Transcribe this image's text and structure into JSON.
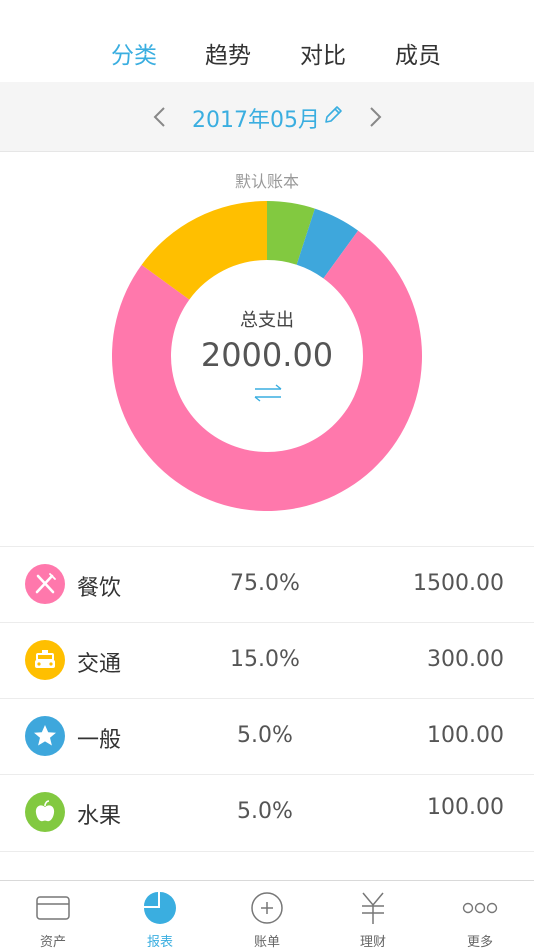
{
  "top_tabs": [
    {
      "label": "分类",
      "active": true
    },
    {
      "label": "趋势",
      "active": false
    },
    {
      "label": "对比",
      "active": false
    },
    {
      "label": "成员",
      "active": false
    }
  ],
  "date_bar": {
    "label": "2017年05月"
  },
  "book_name": "默认账本",
  "summary": {
    "title": "总支出",
    "total": "2000.00"
  },
  "categories": [
    {
      "name": "餐饮",
      "percent": "75.0%",
      "amount": "1500.00",
      "color": "#ff78ac",
      "icon": "fork-knife-icon"
    },
    {
      "name": "交通",
      "percent": "15.0%",
      "amount": "300.00",
      "color": "#ffbf00",
      "icon": "taxi-icon"
    },
    {
      "name": "一般",
      "percent": "5.0%",
      "amount": "100.00",
      "color": "#3ea7dc",
      "icon": "star-icon"
    },
    {
      "name": "水果",
      "percent": "5.0%",
      "amount": "100.00",
      "color": "#82c940",
      "icon": "apple-icon"
    }
  ],
  "chart_data": {
    "type": "pie",
    "categories": [
      "餐饮",
      "交通",
      "一般",
      "水果"
    ],
    "values": [
      1500,
      300,
      100,
      100
    ],
    "colors": [
      "#ff78ac",
      "#ffbf00",
      "#3ea7dc",
      "#82c940"
    ],
    "title": "总支出"
  },
  "tabbar": [
    {
      "label": "资产",
      "icon": "card-icon",
      "active": false
    },
    {
      "label": "报表",
      "icon": "pie-chart-icon",
      "active": true
    },
    {
      "label": "账单",
      "icon": "add-circle-icon",
      "active": false
    },
    {
      "label": "理财",
      "icon": "yen-icon",
      "active": false
    },
    {
      "label": "更多",
      "icon": "more-dots-icon",
      "active": false
    }
  ]
}
